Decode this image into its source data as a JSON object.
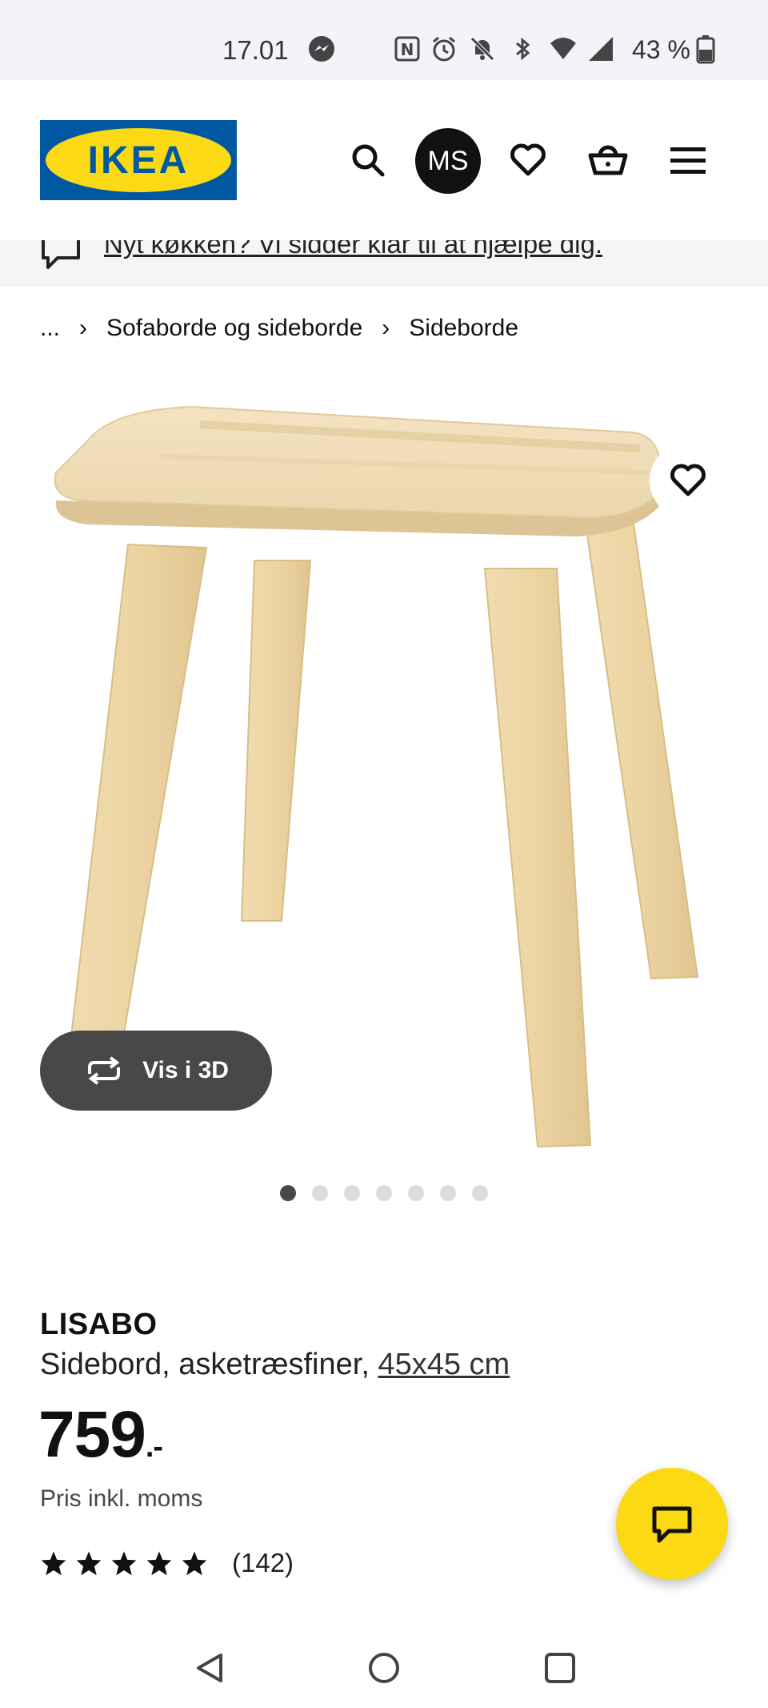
{
  "status_bar": {
    "time": "17.01",
    "battery": "43 %"
  },
  "header": {
    "logo_text": "IKEA",
    "avatar_initials": "MS"
  },
  "banner": {
    "text": "Nyt køkken? Vi sidder klar til at hjælpe dig."
  },
  "breadcrumb": {
    "ellipsis": "...",
    "items": [
      "Sofaborde og sideborde",
      "Sideborde"
    ]
  },
  "gallery": {
    "view3d_label": "Vis i 3D",
    "image_count": 7,
    "active_index": 0
  },
  "product": {
    "name": "LISABO",
    "description": "Sidebord, asketræsfiner,",
    "size_link": "45x45 cm",
    "price": "759",
    "price_suffix": ".-",
    "vat_note": "Pris inkl. moms",
    "rating_stars": 5,
    "review_count": "(142)"
  },
  "colors": {
    "ikea_blue": "#0058a3",
    "ikea_yellow": "#fbd914",
    "dark_pill": "#484848"
  }
}
